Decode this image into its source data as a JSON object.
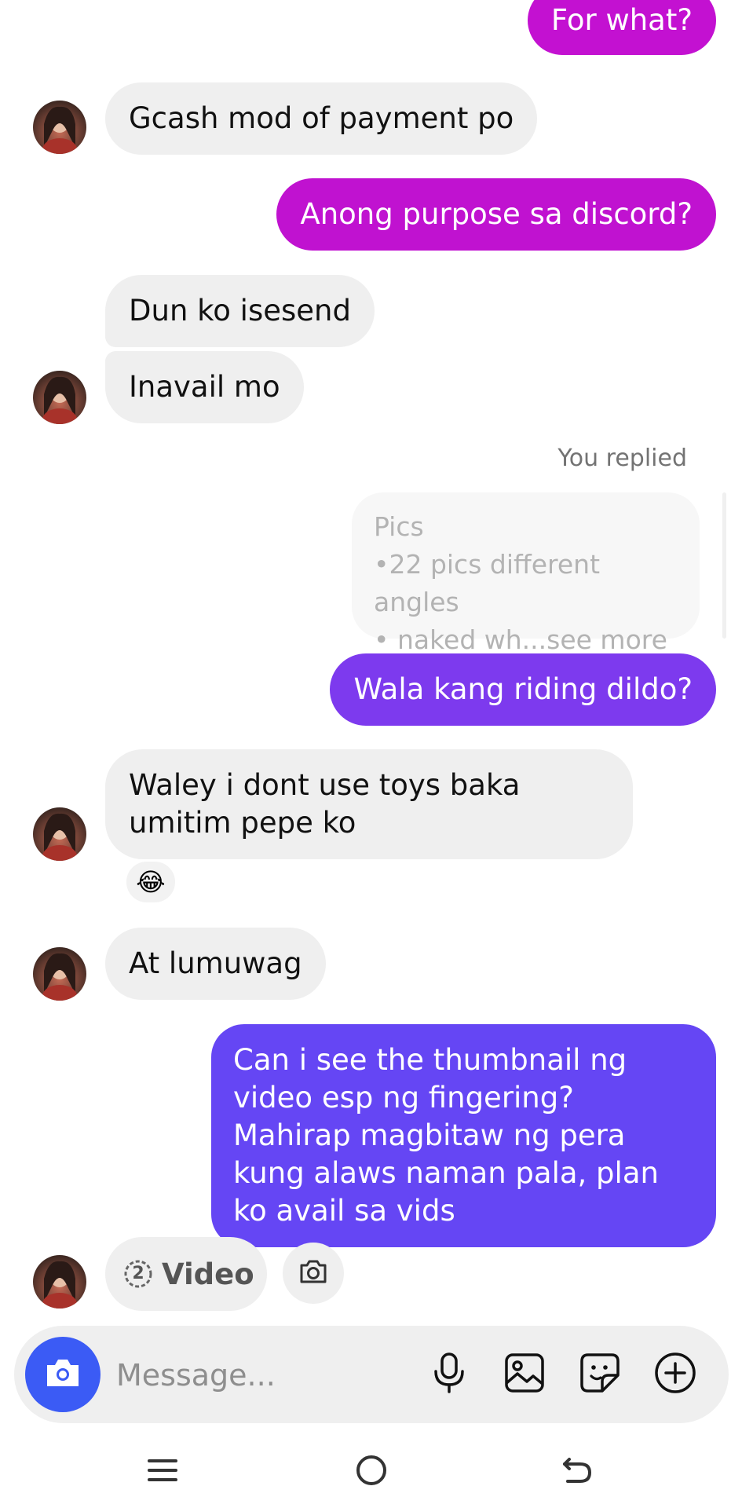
{
  "colors": {
    "incoming_bubble": "#efefef",
    "outgoing_magenta": "#c311d1",
    "outgoing_purple": "#7c3aed",
    "outgoing_indigo": "#6546f4",
    "camera_button": "#3b5bf5"
  },
  "messages": [
    {
      "direction": "outgoing",
      "text": "For what?"
    },
    {
      "direction": "incoming",
      "text": "Gcash mod of payment po"
    },
    {
      "direction": "outgoing",
      "text": "Anong purpose sa discord?"
    },
    {
      "direction": "incoming",
      "text": "Dun ko isesend"
    },
    {
      "direction": "incoming",
      "text": "Inavail mo"
    },
    {
      "direction": "outgoing",
      "text": "Wala kang riding dildo?"
    },
    {
      "direction": "incoming",
      "text": "Waley i dont use toys baka umitim pepe ko",
      "reaction": "😂"
    },
    {
      "direction": "incoming",
      "text": "At lumuwag"
    },
    {
      "direction": "outgoing",
      "text": "Can i see the thumbnail ng video esp ng fingering? Mahirap magbitaw ng pera kung alaws naman pala, plan ko avail sa vids"
    }
  ],
  "reply": {
    "label": "You replied",
    "line1": "Pics",
    "line2": "•22 pics different angles",
    "line3": "• naked wh...see more"
  },
  "attachment": {
    "video_count": "2",
    "video_label": "Video",
    "icon": "camera-icon"
  },
  "composer": {
    "placeholder": "Message...",
    "icons": [
      "camera-icon",
      "microphone-icon",
      "gallery-icon",
      "sticker-icon",
      "plus-icon"
    ]
  },
  "navbar": {
    "icons": [
      "menu-icon",
      "home-icon",
      "back-icon"
    ]
  }
}
